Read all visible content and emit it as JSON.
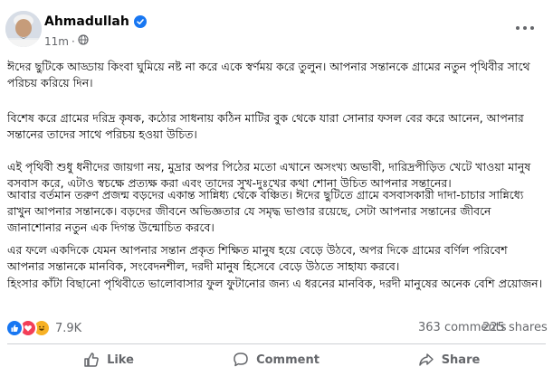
{
  "post": {
    "author": "Ahmadullah",
    "time": "11m",
    "paragraphs": [
      "ঈদের ছুটিকে আড্ডায় কিংবা ঘুমিয়ে নষ্ট না করে একে স্বর্ণময় করে তুলুন। আপনার সন্তানকে গ্রামের নতুন পৃথিবীর সাথে পরিচয় করিয়ে দিন।",
      "বিশেষ করে গ্রামের দরিদ্র কৃষক, কঠোর সাধনায় কঠিন মাটির বুক থেকে যারা সোনার ফসল বের করে আনেন, আপনার সন্তানের তাদের সাথে পরিচয় হওয়া উচিত।",
      "এই পৃথিবী শুধু ধনীদের জায়গা নয়, মুদ্রার অপর পিঠের মতো এখানে অসংখ্য অভাবী, দারিদ্রপীড়িত খেটে খাওয়া মানুষ বসবাস করে, এটাও স্বচক্ষে প্রত্যক্ষ করা এবং তাদের সুখ-দুঃখের কথা শোনা উচিত আপনার সন্তানের।",
      "আবার বর্তমান তরুণ প্রজন্ম বড়দের একান্ত সান্নিধ্য থেকে বঞ্চিত। ঈদের ছুটিতে গ্রামে বসবাসকারী দাদা-চাচার সান্নিধ্যে রাখুন আপনার সন্তানকে। বড়দের জীবনে অভিজ্ঞতার যে সমৃদ্ধ ভাণ্ডার রয়েছে, সেটা আপনার সন্তানের জীবনে জানাশোনার নতুন এক দিগন্ত উন্মোচিত করবে।",
      "এর ফলে একদিকে যেমন আপনার সন্তান প্রকৃত শিক্ষিত মানুষ হয়ে বেড়ে উঠবে, অপর দিকে গ্রামের বর্ণিল পরিবেশ আপনার সন্তানকে মানবিক, সংবেদনশীল, দরদী মানুষ হিসেবে বেড়ে উঠতে সাহায্য করবে।",
      "হিংসার কাঁটা বিছানো পৃথিবীতে ভালোবাসার ফুল ফুটানোর জন্য এ ধরনের মানবিক, দরদী মানুষের অনেক বেশি প্রয়োজন।"
    ],
    "reaction_count": "7.9K",
    "comments": "363 comments",
    "shares": "225 shares",
    "actions": {
      "like": "Like",
      "comment": "Comment",
      "share": "Share"
    }
  },
  "colors": {
    "brand": "#1877f2",
    "text": "#050505",
    "muted": "#65676b",
    "love": "#f33e58",
    "haha": "#f7b125"
  },
  "icons": [
    "verified-badge-icon",
    "globe-icon",
    "more-options-icon",
    "like-reaction-icon",
    "love-reaction-icon",
    "haha-reaction-icon",
    "like-icon",
    "comment-icon",
    "share-icon"
  ]
}
